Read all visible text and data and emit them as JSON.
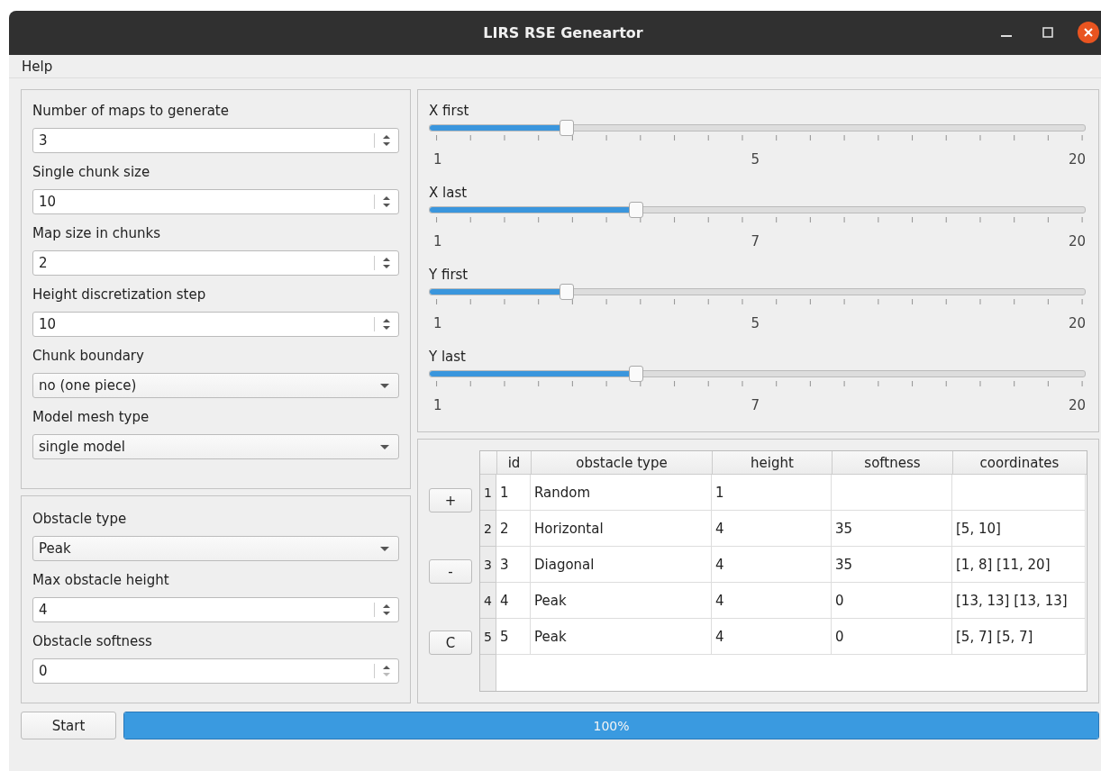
{
  "window": {
    "title": "LIRS RSE Geneartor"
  },
  "menu": [
    {
      "label": "Help"
    }
  ],
  "settings": [
    {
      "kind": "spin",
      "label": "Number of maps to generate",
      "value": "3",
      "down_disabled": false
    },
    {
      "kind": "spin",
      "label": "Single chunk size",
      "value": "10",
      "down_disabled": false
    },
    {
      "kind": "spin",
      "label": "Map size in chunks",
      "value": "2",
      "down_disabled": false
    },
    {
      "kind": "spin",
      "label": "Height discretization step",
      "value": "10",
      "down_disabled": false
    },
    {
      "kind": "combo",
      "label": "Chunk boundary",
      "value": "no (one piece)"
    },
    {
      "kind": "combo",
      "label": "Model mesh type",
      "value": "single model"
    }
  ],
  "obstacle_settings": [
    {
      "kind": "combo",
      "label": "Obstacle type",
      "value": "Peak"
    },
    {
      "kind": "spin",
      "label": "Max obstacle height",
      "value": "4",
      "down_disabled": false
    },
    {
      "kind": "spin",
      "label": "Obstacle softness",
      "value": "0",
      "down_disabled": true
    }
  ],
  "sliders": [
    {
      "label": "X first",
      "level": 0.21,
      "min_label": "1",
      "mid_label": "5",
      "max_label": "20"
    },
    {
      "label": "X last",
      "level": 0.316,
      "min_label": "1",
      "mid_label": "7",
      "max_label": "20"
    },
    {
      "label": "Y first",
      "level": 0.21,
      "min_label": "1",
      "mid_label": "5",
      "max_label": "20"
    },
    {
      "label": "Y last",
      "level": 0.316,
      "min_label": "1",
      "mid_label": "7",
      "max_label": "20"
    }
  ],
  "table_buttons": [
    "+",
    "-",
    "C"
  ],
  "table": {
    "columns": [
      "id",
      "obstacle type",
      "height",
      "softness",
      "coordinates"
    ],
    "rows": [
      {
        "number": "1",
        "cells": [
          "1",
          "Random",
          "1",
          null,
          null
        ]
      },
      {
        "number": "2",
        "cells": [
          "2",
          "Horizontal",
          "4",
          "35",
          "[5, 10]"
        ]
      },
      {
        "number": "3",
        "cells": [
          "3",
          "Diagonal",
          "4",
          "35",
          "[1, 8] [11, 20]"
        ]
      },
      {
        "number": "4",
        "cells": [
          "4",
          "Peak",
          "4",
          "0",
          "[13, 13] [13, 13]"
        ]
      },
      {
        "number": "5",
        "cells": [
          "5",
          "Peak",
          "4",
          "0",
          "[5, 7] [5, 7]"
        ]
      }
    ]
  },
  "start_button": "Start",
  "progress": {
    "level": 1,
    "text": "100%"
  }
}
